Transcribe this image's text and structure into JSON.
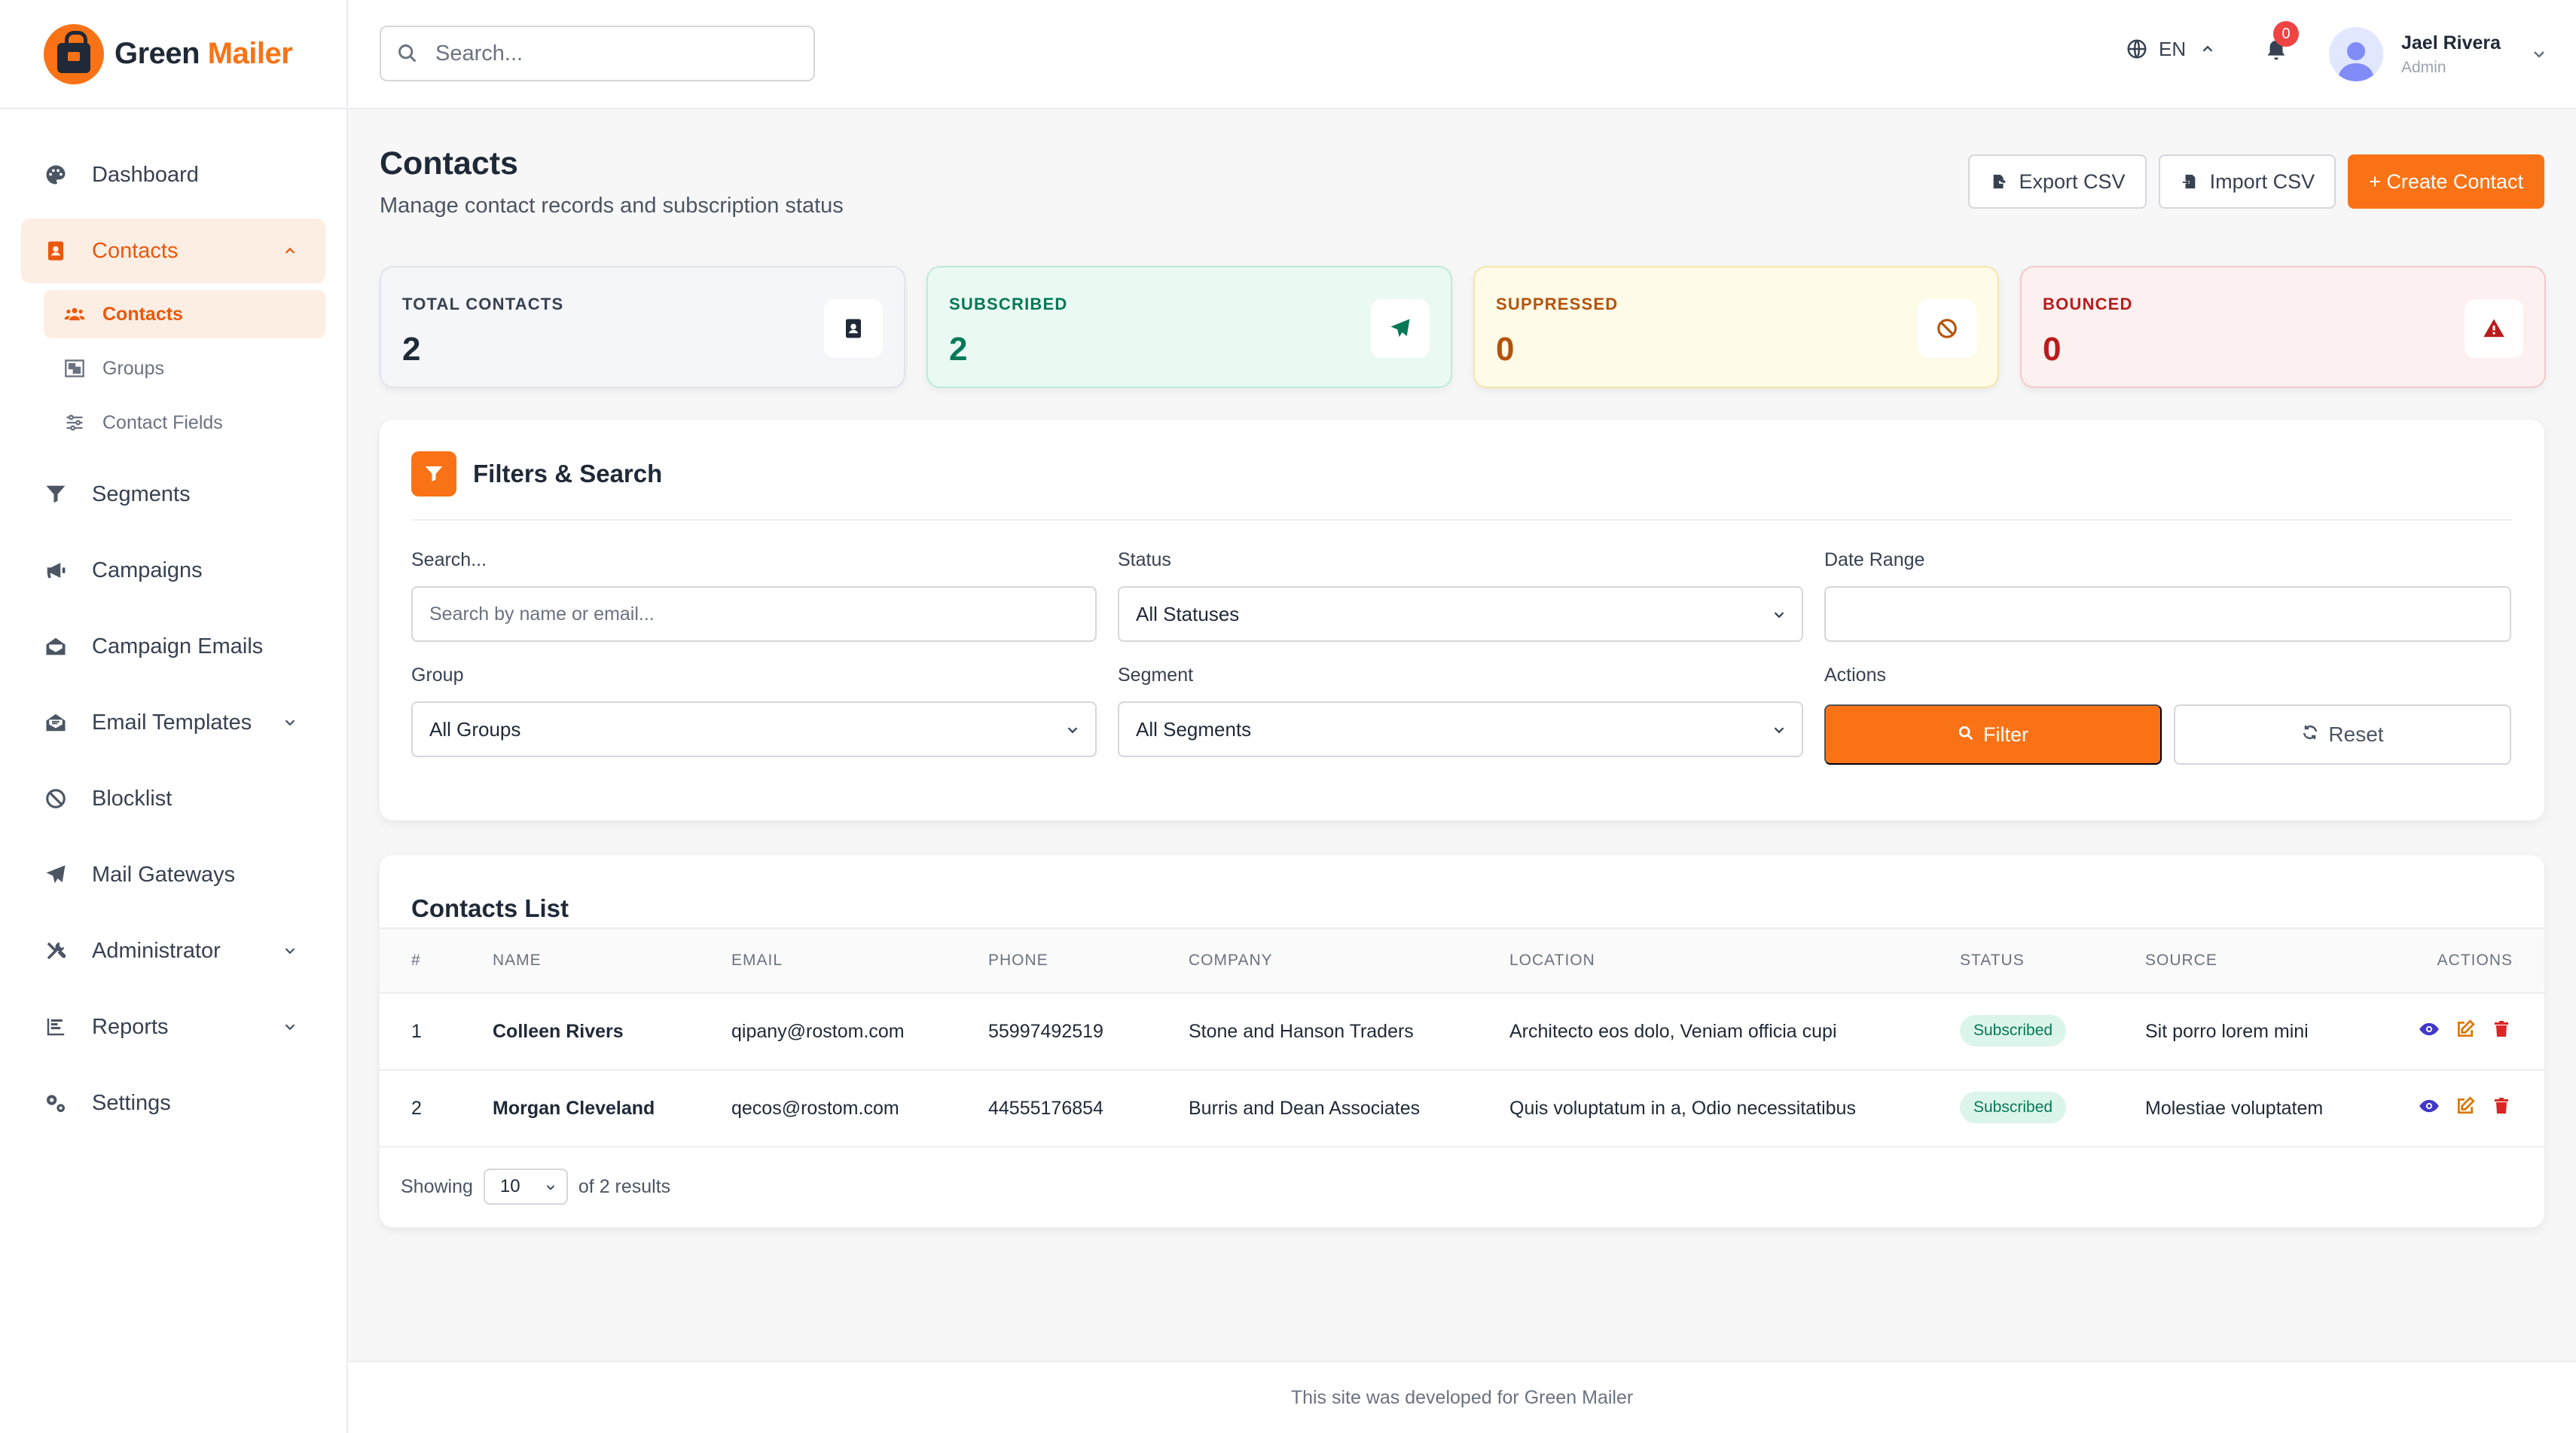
{
  "brand": {
    "part1": "Green",
    "part2": "Mailer",
    "accent": "#f97316"
  },
  "sidebar": {
    "items": [
      {
        "label": "Dashboard",
        "icon": "palette-icon"
      },
      {
        "label": "Contacts",
        "icon": "address-book-icon",
        "active": true,
        "expanded": true,
        "children": [
          {
            "label": "Contacts",
            "icon": "users-icon",
            "active": true
          },
          {
            "label": "Groups",
            "icon": "object-group-icon"
          },
          {
            "label": "Contact Fields",
            "icon": "sliders-icon"
          }
        ]
      },
      {
        "label": "Segments",
        "icon": "filter-icon"
      },
      {
        "label": "Campaigns",
        "icon": "megaphone-icon"
      },
      {
        "label": "Campaign Emails",
        "icon": "envelope-open-icon"
      },
      {
        "label": "Email Templates",
        "icon": "envelope-open-text-icon",
        "has_children": true
      },
      {
        "label": "Blocklist",
        "icon": "ban-icon"
      },
      {
        "label": "Mail Gateways",
        "icon": "paper-plane-icon"
      },
      {
        "label": "Administrator",
        "icon": "tools-icon",
        "has_children": true
      },
      {
        "label": "Reports",
        "icon": "chart-bar-icon",
        "has_children": true
      },
      {
        "label": "Settings",
        "icon": "cogs-icon"
      }
    ]
  },
  "header": {
    "search_placeholder": "Search...",
    "language": "EN",
    "notifications_count": "0",
    "user": {
      "name": "Jael Rivera",
      "role": "Admin"
    }
  },
  "page": {
    "title": "Contacts",
    "subtitle": "Manage contact records and subscription status",
    "actions": {
      "export": "Export CSV",
      "import": "Import CSV",
      "create": "+ Create Contact"
    }
  },
  "stats": [
    {
      "label": "TOTAL CONTACTS",
      "value": "2",
      "icon": "address-book-icon"
    },
    {
      "label": "SUBSCRIBED",
      "value": "2",
      "icon": "paper-plane-icon"
    },
    {
      "label": "SUPPRESSED",
      "value": "0",
      "icon": "ban-icon"
    },
    {
      "label": "BOUNCED",
      "value": "0",
      "icon": "warning-icon"
    }
  ],
  "filters": {
    "title": "Filters & Search",
    "search_label": "Search...",
    "search_placeholder": "Search by name or email...",
    "status_label": "Status",
    "status_value": "All Statuses",
    "date_label": "Date Range",
    "date_value": "",
    "group_label": "Group",
    "group_value": "All Groups",
    "segment_label": "Segment",
    "segment_value": "All Segments",
    "actions_label": "Actions",
    "filter_button": "Filter",
    "reset_button": "Reset"
  },
  "contacts_list": {
    "title": "Contacts List",
    "columns": [
      "#",
      "NAME",
      "EMAIL",
      "PHONE",
      "COMPANY",
      "LOCATION",
      "STATUS",
      "SOURCE",
      "ACTIONS"
    ],
    "rows": [
      {
        "num": "1",
        "name": "Colleen Rivers",
        "email": "qipany@rostom.com",
        "phone": "55997492519",
        "company": "Stone and Hanson Traders",
        "location": "Architecto eos dolo, Veniam officia cupi",
        "status": "Subscribed",
        "source": "Sit porro lorem mini"
      },
      {
        "num": "2",
        "name": "Morgan Cleveland",
        "email": "qecos@rostom.com",
        "phone": "44555176854",
        "company": "Burris and Dean Associates",
        "location": "Quis voluptatum in a, Odio necessitatibus",
        "status": "Subscribed",
        "source": "Molestiae voluptatem"
      }
    ],
    "pager": {
      "showing": "Showing",
      "per_page": "10",
      "results": "of 2 results"
    }
  },
  "footer": {
    "text": "This site was developed for Green Mailer"
  }
}
